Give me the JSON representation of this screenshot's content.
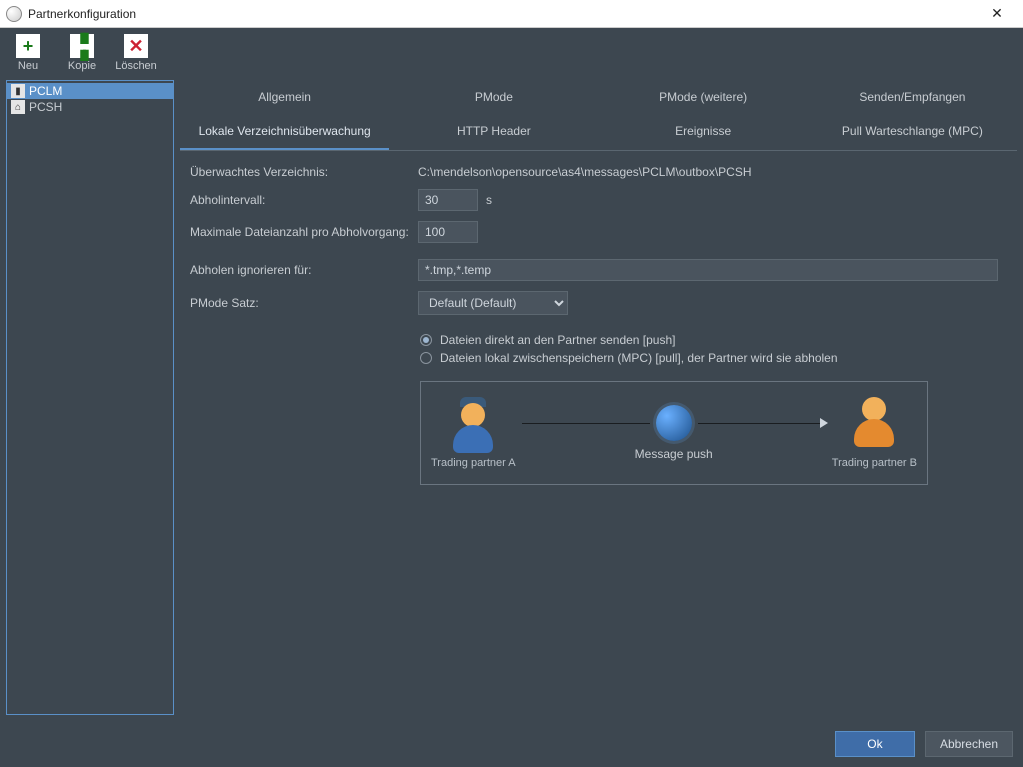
{
  "window": {
    "title": "Partnerkonfiguration"
  },
  "toolbar": {
    "new_label": "Neu",
    "copy_label": "Kopie",
    "delete_label": "Löschen"
  },
  "sidebar": {
    "items": [
      {
        "label": "PCLM",
        "selected": true
      },
      {
        "label": "PCSH",
        "selected": false
      }
    ]
  },
  "tabs_row1": [
    {
      "label": "Allgemein"
    },
    {
      "label": "PMode"
    },
    {
      "label": "PMode (weitere)"
    },
    {
      "label": "Senden/Empfangen"
    }
  ],
  "tabs_row2": [
    {
      "label": "Lokale Verzeichnisüberwachung",
      "active": true
    },
    {
      "label": "HTTP Header"
    },
    {
      "label": "Ereignisse"
    },
    {
      "label": "Pull Warteschlange (MPC)"
    }
  ],
  "form": {
    "watched_dir_label": "Überwachtes Verzeichnis:",
    "watched_dir_value": "C:\\mendelson\\opensource\\as4\\messages\\PCLM\\outbox\\PCSH",
    "interval_label": "Abholintervall:",
    "interval_value": "30",
    "interval_unit": "s",
    "maxfiles_label": "Maximale Dateianzahl pro Abholvorgang:",
    "maxfiles_value": "100",
    "ignore_label": "Abholen ignorieren für:",
    "ignore_value": "*.tmp,*.temp",
    "pmode_label": "PMode Satz:",
    "pmode_value": "Default (Default)",
    "radio_push": "Dateien direkt an den Partner senden [push]",
    "radio_pull": "Dateien lokal zwischenspeichern (MPC) [pull], der Partner wird sie abholen"
  },
  "diagram": {
    "partner_a": "Trading partner A",
    "middle": "Message push",
    "partner_b": "Trading partner B"
  },
  "footer": {
    "ok": "Ok",
    "cancel": "Abbrechen"
  }
}
